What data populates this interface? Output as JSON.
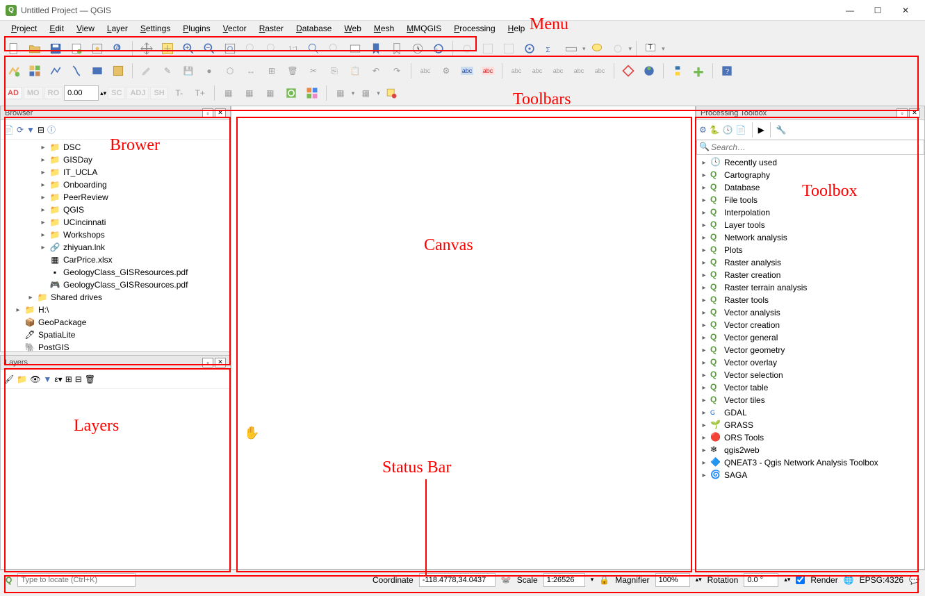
{
  "window": {
    "title": "Untitled Project — QGIS"
  },
  "menu": [
    "Project",
    "Edit",
    "View",
    "Layer",
    "Settings",
    "Plugins",
    "Vector",
    "Raster",
    "Database",
    "Web",
    "Mesh",
    "MMQGIS",
    "Processing",
    "Help"
  ],
  "toolbarRow3": {
    "offset": "0.00"
  },
  "browser": {
    "title": "Browser",
    "items": [
      {
        "indent": 2,
        "exp": "▸",
        "icon": "folder",
        "label": "DSC"
      },
      {
        "indent": 2,
        "exp": "▸",
        "icon": "folder",
        "label": "GISDay"
      },
      {
        "indent": 2,
        "exp": "▸",
        "icon": "folder",
        "label": "IT_UCLA"
      },
      {
        "indent": 2,
        "exp": "▸",
        "icon": "folder",
        "label": "Onboarding"
      },
      {
        "indent": 2,
        "exp": "▸",
        "icon": "folder",
        "label": "PeerReview"
      },
      {
        "indent": 2,
        "exp": "▸",
        "icon": "folder",
        "label": "QGIS"
      },
      {
        "indent": 2,
        "exp": "▸",
        "icon": "folder",
        "label": "UCincinnati"
      },
      {
        "indent": 2,
        "exp": "▸",
        "icon": "folder",
        "label": "Workshops"
      },
      {
        "indent": 2,
        "exp": "▸",
        "icon": "link",
        "label": "zhiyuan.lnk"
      },
      {
        "indent": 2,
        "exp": "",
        "icon": "xls",
        "label": "CarPrice.xlsx"
      },
      {
        "indent": 2,
        "exp": "",
        "icon": "pdf",
        "label": "GeologyClass_GISResources.pdf"
      },
      {
        "indent": 2,
        "exp": "",
        "icon": "pdf2",
        "label": "GeologyClass_GISResources.pdf"
      },
      {
        "indent": 1,
        "exp": "▸",
        "icon": "folder",
        "label": "Shared drives"
      },
      {
        "indent": 0,
        "exp": "▸",
        "icon": "folder",
        "label": "H:\\"
      },
      {
        "indent": 0,
        "exp": "",
        "icon": "geopkg",
        "label": "GeoPackage"
      },
      {
        "indent": 0,
        "exp": "",
        "icon": "spatialite",
        "label": "SpatiaLite"
      },
      {
        "indent": 0,
        "exp": "",
        "icon": "postgis",
        "label": "PostGIS"
      }
    ]
  },
  "layers": {
    "title": "Layers"
  },
  "toolbox": {
    "title": "Processing Toolbox",
    "searchPlaceholder": "Search…",
    "items": [
      {
        "icon": "clock",
        "label": "Recently used"
      },
      {
        "icon": "q",
        "label": "Cartography"
      },
      {
        "icon": "q",
        "label": "Database"
      },
      {
        "icon": "q",
        "label": "File tools"
      },
      {
        "icon": "q",
        "label": "Interpolation"
      },
      {
        "icon": "q",
        "label": "Layer tools"
      },
      {
        "icon": "q",
        "label": "Network analysis"
      },
      {
        "icon": "q",
        "label": "Plots"
      },
      {
        "icon": "q",
        "label": "Raster analysis"
      },
      {
        "icon": "q",
        "label": "Raster creation"
      },
      {
        "icon": "q",
        "label": "Raster terrain analysis"
      },
      {
        "icon": "q",
        "label": "Raster tools"
      },
      {
        "icon": "q",
        "label": "Vector analysis"
      },
      {
        "icon": "q",
        "label": "Vector creation"
      },
      {
        "icon": "q",
        "label": "Vector general"
      },
      {
        "icon": "q",
        "label": "Vector geometry"
      },
      {
        "icon": "q",
        "label": "Vector overlay"
      },
      {
        "icon": "q",
        "label": "Vector selection"
      },
      {
        "icon": "q",
        "label": "Vector table"
      },
      {
        "icon": "q",
        "label": "Vector tiles"
      },
      {
        "icon": "gdal",
        "label": "GDAL"
      },
      {
        "icon": "grass",
        "label": "GRASS"
      },
      {
        "icon": "ors",
        "label": "ORS Tools"
      },
      {
        "icon": "q2w",
        "label": "qgis2web"
      },
      {
        "icon": "qneat",
        "label": "QNEAT3 - Qgis Network Analysis Toolbox"
      },
      {
        "icon": "saga",
        "label": "SAGA"
      }
    ]
  },
  "status": {
    "locatePlaceholder": "Type to locate (Ctrl+K)",
    "coordLabel": "Coordinate",
    "coordValue": "-118.4778,34.0437",
    "scaleLabel": "Scale",
    "scaleValue": "1:26526",
    "magLabel": "Magnifier",
    "magValue": "100%",
    "rotLabel": "Rotation",
    "rotValue": "0.0 °",
    "renderLabel": "Render",
    "crsLabel": "EPSG:4326"
  },
  "annotations": {
    "menu": "Menu",
    "toolbars": "Toolbars",
    "browser": "Brower",
    "canvas": "Canvas",
    "toolbox": "Toolbox",
    "layers": "Layers",
    "statusbar": "Status Bar"
  }
}
